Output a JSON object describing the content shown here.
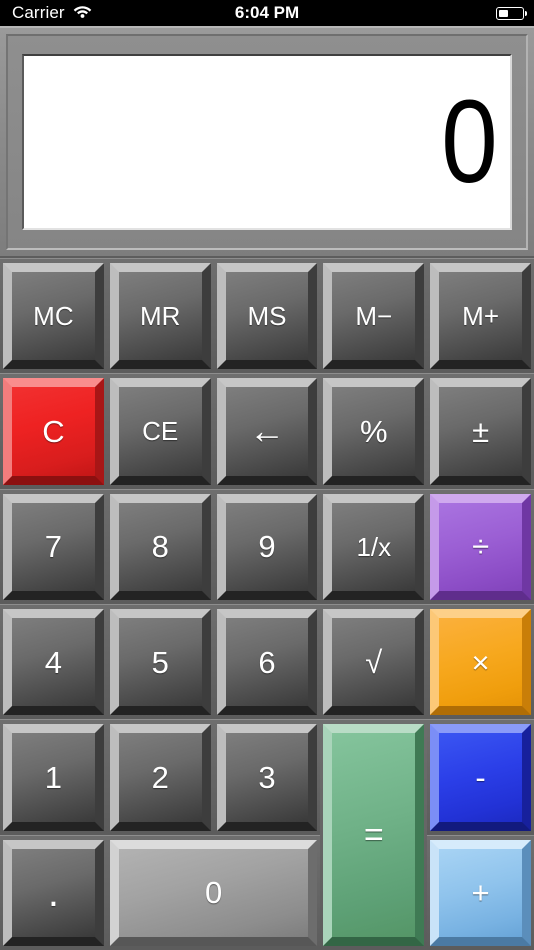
{
  "status_bar": {
    "carrier": "Carrier",
    "wifi_icon": "wifi-icon",
    "time": "6:04 PM",
    "battery_icon": "battery-icon"
  },
  "display": {
    "value": "0"
  },
  "keypad": {
    "keys": [
      {
        "label": "MC",
        "name": "memory-clear-button",
        "style": "gray"
      },
      {
        "label": "MR",
        "name": "memory-recall-button",
        "style": "gray"
      },
      {
        "label": "MS",
        "name": "memory-store-button",
        "style": "gray"
      },
      {
        "label": "M−",
        "name": "memory-subtract-button",
        "style": "gray"
      },
      {
        "label": "M+",
        "name": "memory-add-button",
        "style": "gray"
      },
      {
        "label": "C",
        "name": "clear-button",
        "style": "red"
      },
      {
        "label": "CE",
        "name": "clear-entry-button",
        "style": "gray"
      },
      {
        "label": "←",
        "name": "backspace-icon",
        "style": "gray"
      },
      {
        "label": "%",
        "name": "percent-button",
        "style": "gray"
      },
      {
        "label": "±",
        "name": "plus-minus-button",
        "style": "gray"
      },
      {
        "label": "7",
        "name": "digit-7-button",
        "style": "gray"
      },
      {
        "label": "8",
        "name": "digit-8-button",
        "style": "gray"
      },
      {
        "label": "9",
        "name": "digit-9-button",
        "style": "gray"
      },
      {
        "label": "1/x",
        "name": "reciprocal-button",
        "style": "gray"
      },
      {
        "label": "÷",
        "name": "divide-button",
        "style": "purple"
      },
      {
        "label": "4",
        "name": "digit-4-button",
        "style": "gray"
      },
      {
        "label": "5",
        "name": "digit-5-button",
        "style": "gray"
      },
      {
        "label": "6",
        "name": "digit-6-button",
        "style": "gray"
      },
      {
        "label": "√",
        "name": "square-root-button",
        "style": "gray"
      },
      {
        "label": "×",
        "name": "multiply-button",
        "style": "orange"
      },
      {
        "label": "1",
        "name": "digit-1-button",
        "style": "gray"
      },
      {
        "label": "2",
        "name": "digit-2-button",
        "style": "gray"
      },
      {
        "label": "3",
        "name": "digit-3-button",
        "style": "gray"
      },
      {
        "label": "=",
        "name": "equals-button",
        "style": "green"
      },
      {
        "label": "-",
        "name": "minus-button",
        "style": "blue"
      },
      {
        "label": ".",
        "name": "decimal-point-button",
        "style": "gray"
      },
      {
        "label": "0",
        "name": "digit-0-button",
        "style": "light"
      },
      {
        "label": "+",
        "name": "plus-button",
        "style": "lightblue"
      }
    ]
  },
  "colors": {
    "clear_red": "#ee2222",
    "divide_purple": "#9b5fd4",
    "multiply_orange": "#f7a81e",
    "minus_blue": "#2b3fe8",
    "plus_lightblue": "#8fc3ec",
    "equals_green": "#6fb187",
    "key_gray": "#6a6a6a",
    "zero_gray": "#a2a2a2",
    "bezel_gray": "#8a8a8a",
    "screen_white": "#ffffff"
  }
}
